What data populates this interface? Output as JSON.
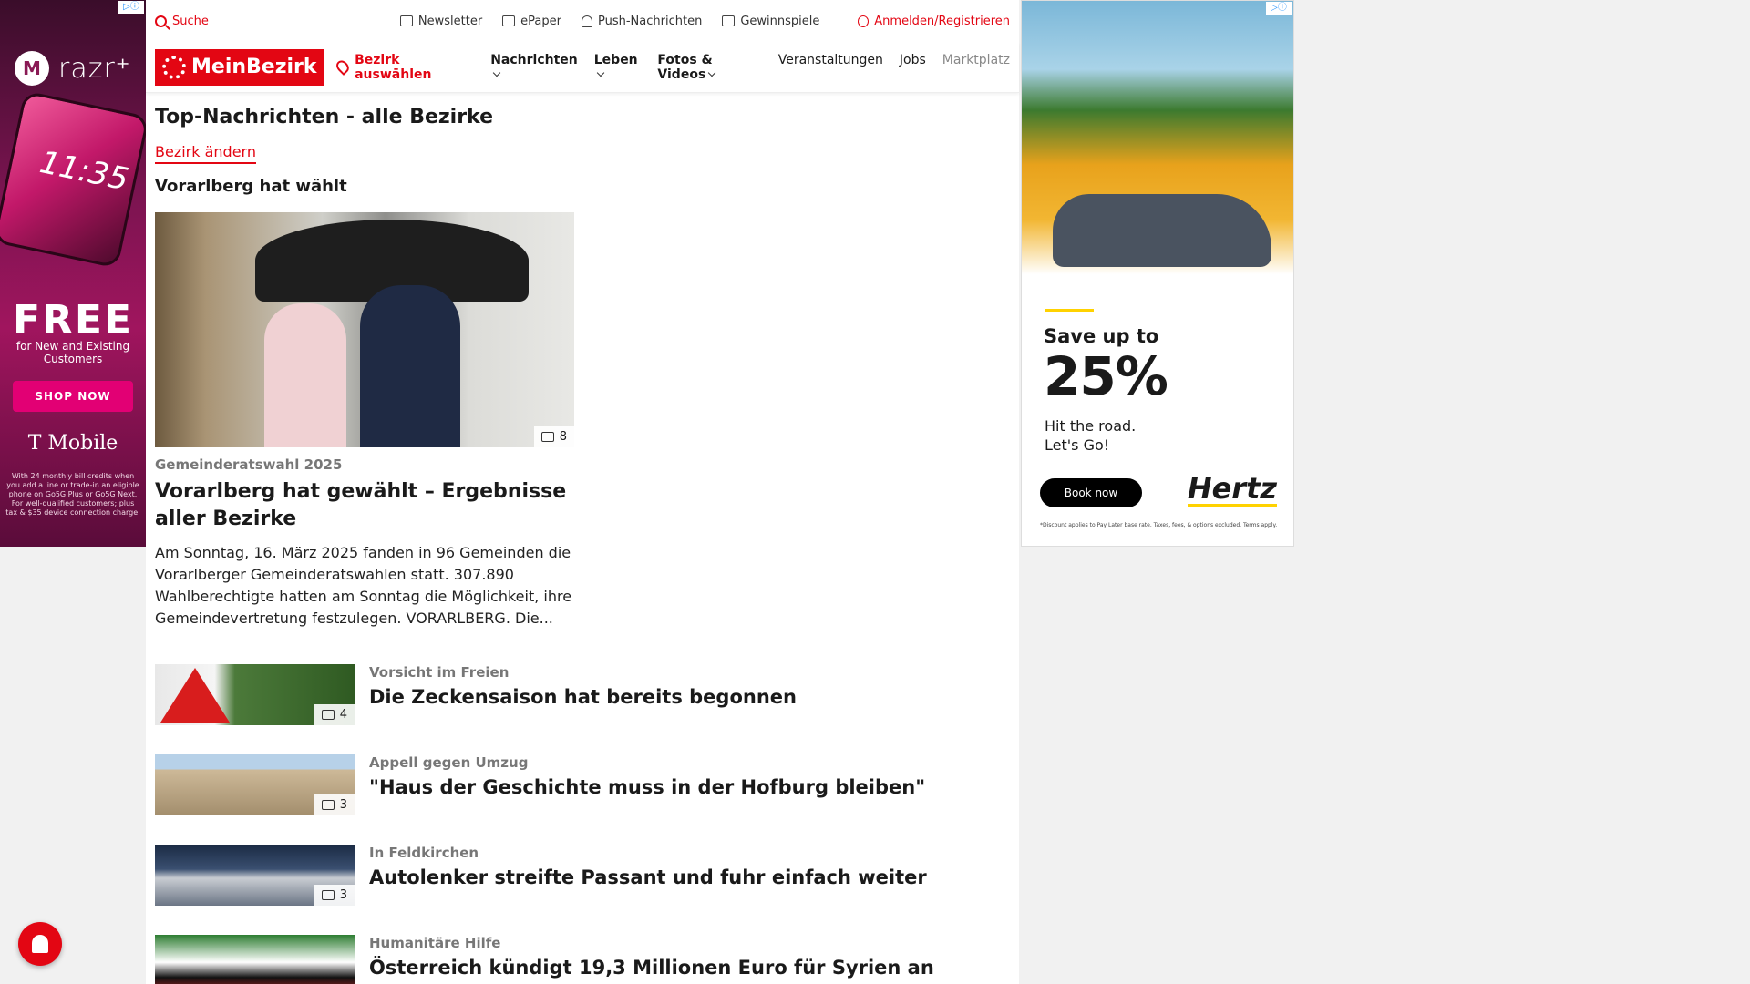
{
  "ad_left": {
    "brand": "razr⁺",
    "moto_letter": "M",
    "phone_time": "11:35",
    "headline": "FREE",
    "sub": "for New and Existing Customers",
    "cta": "SHOP NOW",
    "carrier": "T Mobile",
    "fine_print": "With 24 monthly bill credits when you add a line or trade-in an eligible phone on Go5G Plus or Go5G Next. For well-qualified customers; plus tax & $35 device connection charge."
  },
  "utilbar": {
    "search": "Suche",
    "newsletter": "Newsletter",
    "epaper": "ePaper",
    "push": "Push-Nachrichten",
    "gewinnspiele": "Gewinnspiele",
    "login": "Anmelden/Registrieren"
  },
  "nav": {
    "logo": "MeinBezirk",
    "bezirk": "Bezirk auswählen",
    "links": [
      "Nachrichten",
      "Leben",
      "Fotos & Videos",
      "Veranstaltungen",
      "Jobs",
      "Marktplatz"
    ]
  },
  "page": {
    "title": "Top-Nachrichten - alle Bezirke",
    "change_link": "Bezirk ändern",
    "section": "Vorarlberg hat wählt"
  },
  "lead": {
    "image_count": "8",
    "kicker": "Gemeinderatswahl 2025",
    "headline": "Vorarlberg hat gewählt – Ergebnisse aller Bezirke",
    "teaser": "Am Sonntag, 16. März 2025 fanden in 96 Gemeinden die Vorarlberger Gemeinderatswahlen statt. 307.890 Wahlberechtigte hatten am Sonntag die Möglichkeit, ihre Gemeindevertretung festzulegen. VORARLBERG. Die..."
  },
  "articles": [
    {
      "kicker": "Vorsicht im Freien",
      "headline": "Die Zeckensaison hat bereits begonnen",
      "count": "4"
    },
    {
      "kicker": "Appell gegen Umzug",
      "headline": "\"Haus der Geschichte muss in der Hofburg bleiben\"",
      "count": "3"
    },
    {
      "kicker": "In Feldkirchen",
      "headline": "Autolenker streifte Passant und fuhr einfach weiter",
      "count": "3"
    },
    {
      "kicker": "Humanitäre Hilfe",
      "headline": "Österreich kündigt 19,3 Millionen Euro für Syrien an",
      "count": ""
    }
  ],
  "ad_right": {
    "save": "Save up to",
    "percent": "25%",
    "tagline_1": "Hit the road.",
    "tagline_2": "Let's Go!",
    "cta": "Book now",
    "brand": "Hertz",
    "fine": "*Discount applies to Pay Later base rate. Taxes, fees, & options excluded. Terms apply."
  },
  "adchoice": "▷ⓘ"
}
